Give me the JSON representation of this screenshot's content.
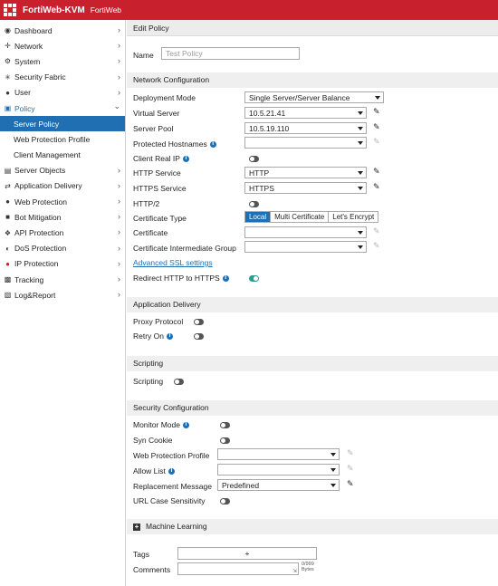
{
  "app": {
    "title": "FortiWeb-KVM",
    "subtitle": "FortiWeb"
  },
  "sidebar": {
    "items": [
      {
        "label": "Dashboard",
        "icon": "dashboard-icon"
      },
      {
        "label": "Network",
        "icon": "network-icon"
      },
      {
        "label": "System",
        "icon": "gear-icon"
      },
      {
        "label": "Security Fabric",
        "icon": "fabric-icon"
      },
      {
        "label": "User",
        "icon": "user-icon"
      },
      {
        "label": "Policy",
        "icon": "policy-icon"
      },
      {
        "label": "Server Objects",
        "icon": "server-icon"
      },
      {
        "label": "Application Delivery",
        "icon": "delivery-icon"
      },
      {
        "label": "Web Protection",
        "icon": "lock-icon"
      },
      {
        "label": "Bot Mitigation",
        "icon": "bot-icon"
      },
      {
        "label": "API Protection",
        "icon": "api-icon"
      },
      {
        "label": "DoS Protection",
        "icon": "dos-icon"
      },
      {
        "label": "IP Protection",
        "icon": "ip-icon"
      },
      {
        "label": "Tracking",
        "icon": "tracking-icon"
      },
      {
        "label": "Log&Report",
        "icon": "chart-icon"
      }
    ],
    "policy_sub": [
      "Server Policy",
      "Web Protection Profile",
      "Client Management"
    ],
    "accent": "#1f6fb2"
  },
  "main": {
    "edit_title": "Edit Policy",
    "name_label": "Name",
    "name_value": "Test Policy",
    "network": {
      "heading": "Network Configuration",
      "deployment_mode_label": "Deployment Mode",
      "deployment_mode_value": "Single Server/Server Balance",
      "virtual_server_label": "Virtual Server",
      "virtual_server_value": "10.5.21.41",
      "server_pool_label": "Server Pool",
      "server_pool_value": "10.5.19.110",
      "protected_hostnames_label": "Protected Hostnames",
      "client_real_ip_label": "Client Real IP",
      "http_service_label": "HTTP Service",
      "http_service_value": "HTTP",
      "https_service_label": "HTTPS Service",
      "https_service_value": "HTTPS",
      "http2_label": "HTTP/2",
      "cert_type_label": "Certificate Type",
      "cert_types": [
        "Local",
        "Multi Certificate",
        "Let's Encrypt"
      ],
      "certificate_label": "Certificate",
      "cert_intermediate_label": "Certificate Intermediate Group",
      "advanced_ssl_link": "Advanced SSL settings",
      "redirect_label": "Redirect HTTP to HTTPS"
    },
    "app_delivery": {
      "heading": "Application Delivery",
      "proxy_protocol_label": "Proxy Protocol",
      "retry_on_label": "Retry On"
    },
    "scripting": {
      "heading": "Scripting",
      "scripting_label": "Scripting"
    },
    "security": {
      "heading": "Security Configuration",
      "monitor_mode_label": "Monitor Mode",
      "syn_cookie_label": "Syn Cookie",
      "wpp_label": "Web Protection Profile",
      "allow_list_label": "Allow List",
      "replacement_label": "Replacement Message",
      "replacement_value": "Predefined",
      "url_case_label": "URL Case Sensitivity"
    },
    "ml": {
      "heading": "Machine Learning"
    },
    "tags_label": "Tags",
    "tags_add": "+",
    "comments_label": "Comments",
    "comments_counter": "0/999",
    "comments_unit": "Bytes",
    "toggle_on_color": "#2a9d8f"
  }
}
